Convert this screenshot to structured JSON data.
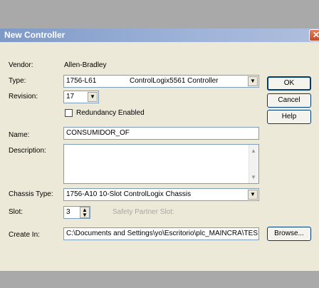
{
  "window": {
    "title": "New Controller",
    "close_glyph": "✕"
  },
  "form": {
    "vendor_label": "Vendor:",
    "vendor_value": "Allen-Bradley",
    "type_label": "Type:",
    "type_code": "1756-L61",
    "type_desc": "ControlLogix5561 Controller",
    "revision_label": "Revision:",
    "revision_value": "17",
    "redundancy_label": "Redundancy Enabled",
    "name_label": "Name:",
    "name_value": "CONSUMIDOR_OF",
    "description_label": "Description:",
    "description_value": "",
    "chassis_label": "Chassis Type:",
    "chassis_value": "1756-A10  10-Slot ControlLogix Chassis",
    "slot_label": "Slot:",
    "slot_value": "3",
    "safety_label": "Safety Partner Slot:",
    "create_label": "Create In:",
    "create_value": "C:\\Documents and Settings\\yo\\Escritorio\\plc_MAINCRA\\TESI"
  },
  "buttons": {
    "ok": "OK",
    "cancel": "Cancel",
    "help": "Help",
    "browse": "Browse..."
  },
  "icons": {
    "dropdown": "chevron-down-icon",
    "close": "close-icon"
  }
}
